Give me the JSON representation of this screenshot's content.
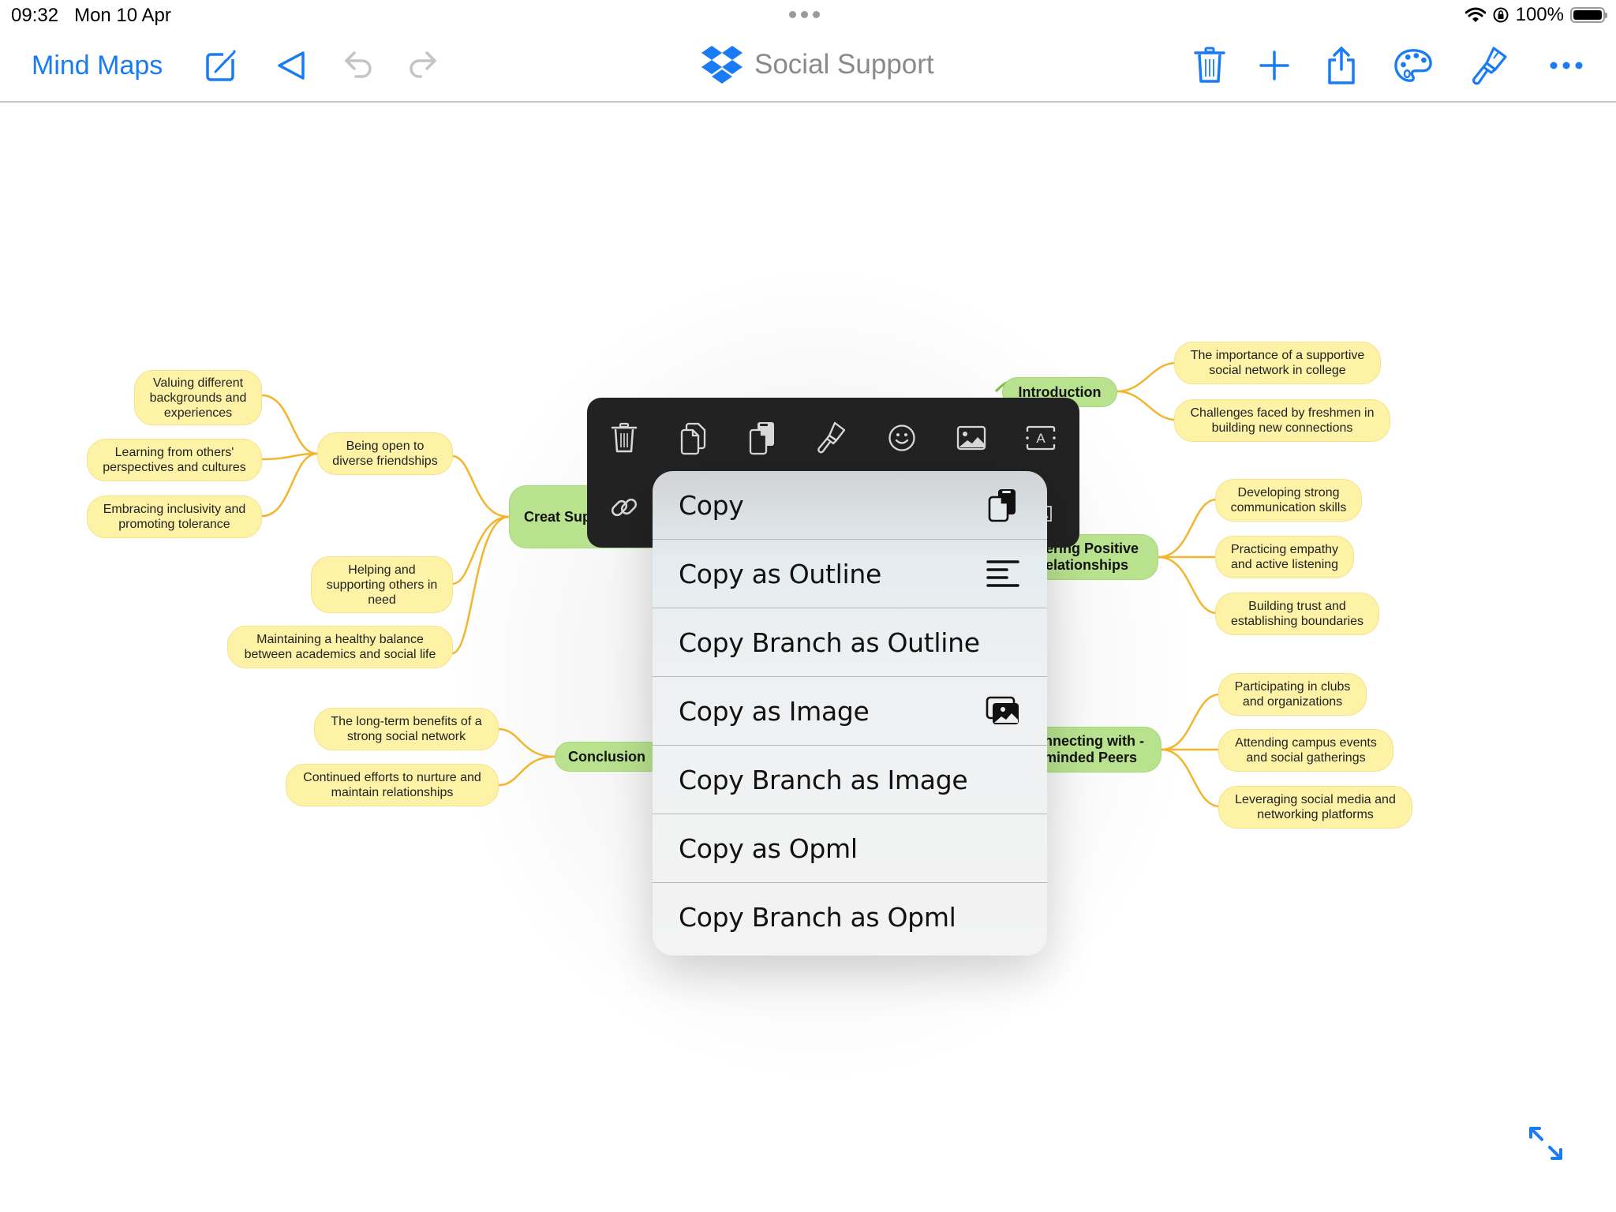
{
  "status_bar": {
    "time": "09:32",
    "date": "Mon 10 Apr",
    "battery_text": "100%",
    "battery_level": 1.0,
    "icons": [
      "wifi-icon",
      "orientation-lock-icon",
      "battery-icon"
    ]
  },
  "toolbar": {
    "back_label": "Mind Maps",
    "title": "Social Support",
    "accent_color": "#1a7cf5",
    "left_icons": [
      "edit-icon",
      "play-icon",
      "undo-icon",
      "redo-icon"
    ],
    "right_icons": [
      "trash-icon",
      "add-icon",
      "share-icon",
      "palette-icon",
      "brush-icon",
      "more-icon"
    ]
  },
  "mind_map": {
    "center_partial": "Social Support",
    "branches": [
      {
        "id": "introduction",
        "label": "Introduction",
        "children": [
          "The importance of a supportive social network in college",
          "Challenges faced by freshmen in building new connections"
        ]
      },
      {
        "id": "fostering",
        "label": "Fostering Positive Relationships",
        "visible_label": "ering Positive\nelationships",
        "children": [
          "Developing strong communication skills",
          "Practicing empathy and active listening",
          "Building trust and establishing boundaries"
        ]
      },
      {
        "id": "connecting",
        "label": "Connecting with Like-minded Peers",
        "visible_label": "nnecting with\n-minded Peers",
        "children": [
          "Participating in clubs and organizations",
          "Attending campus events and social gatherings",
          "Leveraging social media and networking platforms"
        ]
      },
      {
        "id": "creating",
        "label": "Creating Supportive Circle",
        "visible_label": "Creat\nSupportiv\nCir",
        "children": [
          {
            "label": "Being open to diverse friendships",
            "children": [
              "Valuing different backgrounds and experiences",
              "Learning from others' perspectives and cultures",
              "Embracing inclusivity and promoting tolerance"
            ]
          },
          {
            "label": "Helping and supporting others in need"
          },
          {
            "label": "Maintaining a healthy balance between academics and social life"
          }
        ]
      },
      {
        "id": "conclusion",
        "label": "Conclusion",
        "children": [
          "The long-term benefits of a strong social network",
          "Continued efforts to nurture and maintain relationships"
        ]
      }
    ]
  },
  "node_text": {
    "intro": "Introduction",
    "intro_c1": "The importance of a supportive social network in college",
    "intro_c2": "Challenges faced by freshmen in building new connections",
    "foster": "ering Positive elationships",
    "foster_c1": "Developing strong communication skills",
    "foster_c2": "Practicing empathy and active listening",
    "foster_c3": "Building trust and establishing boundaries",
    "connect": "nnecting with -minded Peers",
    "connect_c1": "Participating in clubs and organizations",
    "connect_c2": "Attending campus events and social gatherings",
    "connect_c3": "Leveraging social media and networking platforms",
    "create": "Creat Supportiv Cir",
    "create_c1": "Being open to diverse friendships",
    "create_c1_a": "Valuing different backgrounds and experiences",
    "create_c1_b": "Learning from others' perspectives and cultures",
    "create_c1_c": "Embracing inclusivity and promoting tolerance",
    "create_c2": "Helping and supporting others in need",
    "create_c3": "Maintaining a healthy balance between academics and social life",
    "conclusion": "Conclusion",
    "conclusion_c1": "The long-term benefits of a strong social network",
    "conclusion_c2": "Continued efforts to nurture and maintain relationships"
  },
  "colors": {
    "main_node": "#b8e28e",
    "sub_node": "#fdf2a6",
    "link": "#f2b52b",
    "float_bar": "#222222"
  },
  "float_toolbar": {
    "icons": [
      "trash-icon",
      "duplicate-icon",
      "copy-icon",
      "brush-icon",
      "emoji-icon",
      "image-icon",
      "text-box-icon",
      "link-icon",
      "resize-icon"
    ]
  },
  "context_menu": {
    "items": [
      {
        "label": "Copy",
        "icon": "copy-icon"
      },
      {
        "label": "Copy as Outline",
        "icon": "outline-icon"
      },
      {
        "label": "Copy Branch as Outline",
        "icon": ""
      },
      {
        "label": "Copy as Image",
        "icon": "images-icon"
      },
      {
        "label": "Copy Branch as Image",
        "icon": ""
      },
      {
        "label": "Copy as Opml",
        "icon": ""
      },
      {
        "label": "Copy Branch as Opml",
        "icon": ""
      }
    ]
  }
}
